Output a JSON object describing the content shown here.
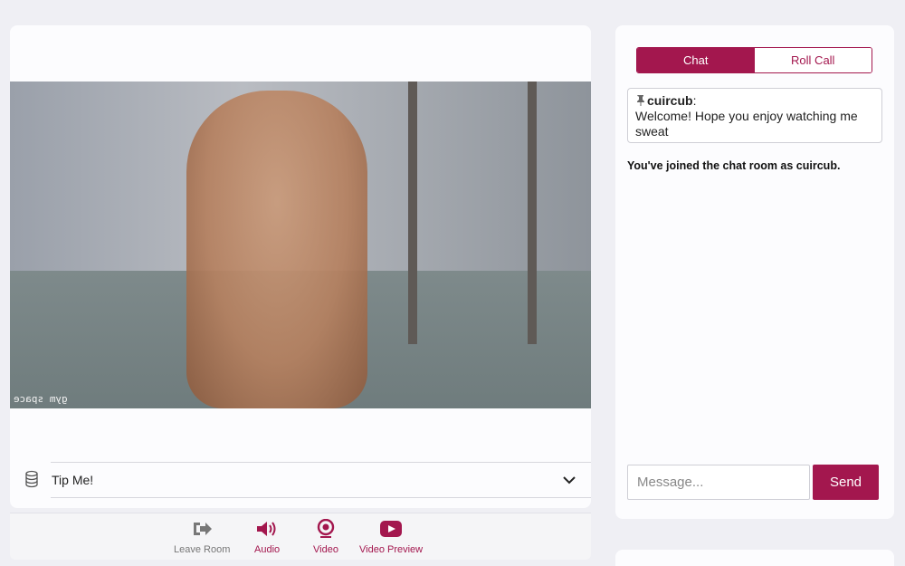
{
  "video": {
    "watermark": "gym space"
  },
  "tip": {
    "label": "Tip Me!"
  },
  "controls": [
    {
      "label": "Leave Room",
      "icon": "leave-icon",
      "color": "#777777"
    },
    {
      "label": "Audio",
      "icon": "speaker-icon",
      "color": "#a3174e"
    },
    {
      "label": "Video",
      "icon": "webcam-icon",
      "color": "#a3174e"
    },
    {
      "label": "Video Preview",
      "icon": "play-icon",
      "color": "#a3174e"
    }
  ],
  "chat": {
    "tabs": [
      {
        "label": "Chat",
        "active": true
      },
      {
        "label": "Roll Call",
        "active": false
      }
    ],
    "pinned": {
      "user": "cuircub",
      "text": "Welcome! Hope you enjoy watching me sweat"
    },
    "system_message": "You've joined the chat room as cuircub.",
    "input_placeholder": "Message...",
    "send_label": "Send"
  },
  "colors": {
    "accent": "#a3174e",
    "background": "#efeff4"
  }
}
